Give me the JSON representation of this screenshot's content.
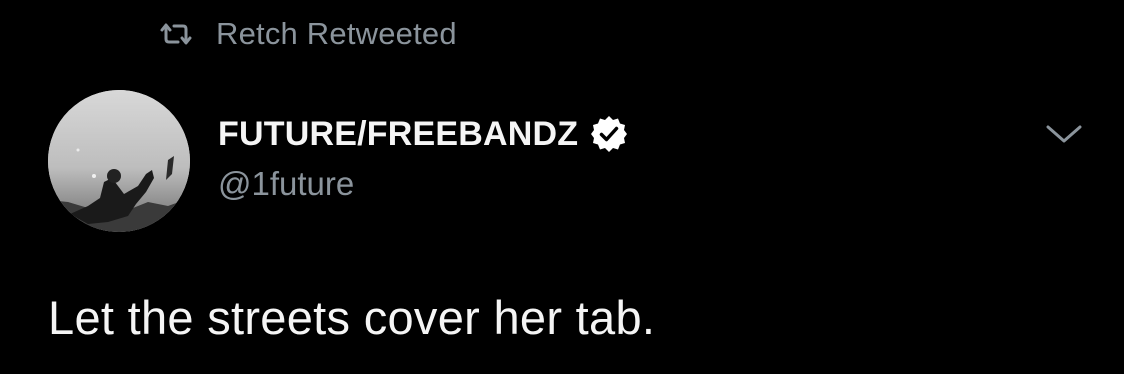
{
  "retweet": {
    "icon": "retweet-icon",
    "label": "Retch Retweeted"
  },
  "author": {
    "display_name": "FUTURE/FREEBANDZ",
    "handle": "@1future",
    "verified": true,
    "verified_icon": "verified-badge-icon",
    "avatar": "profile-photo-grayscale"
  },
  "menu": {
    "icon": "chevron-down-icon"
  },
  "tweet": {
    "text": "Let the streets cover her tab."
  },
  "colors": {
    "background": "#000000",
    "primary_text": "#f5f5f5",
    "secondary_text": "#8b949c"
  }
}
